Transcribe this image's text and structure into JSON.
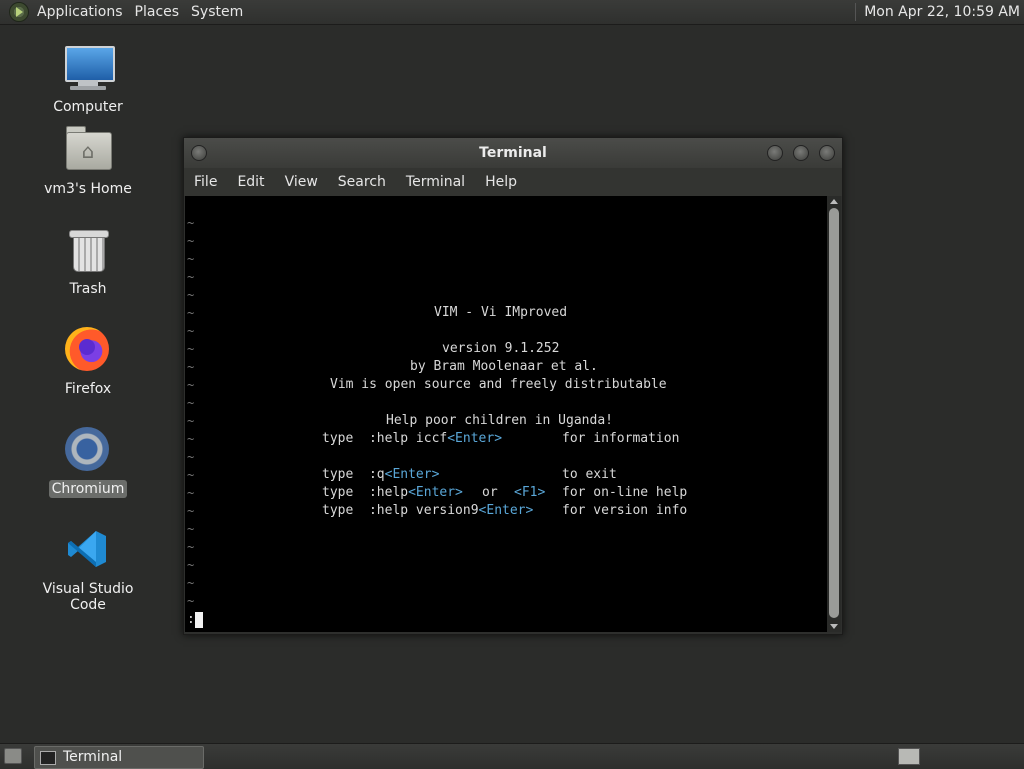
{
  "top_panel": {
    "menus": [
      "Applications",
      "Places",
      "System"
    ],
    "clock": "Mon Apr 22, 10:59 AM"
  },
  "desktop": {
    "icons": [
      {
        "label": "Computer",
        "icon": "computer-icon"
      },
      {
        "label": "vm3's Home",
        "icon": "home-folder-icon"
      },
      {
        "label": "Trash",
        "icon": "trash-icon"
      },
      {
        "label": "Firefox",
        "icon": "firefox-icon"
      },
      {
        "label": "Chromium",
        "icon": "chromium-icon",
        "selected": true
      },
      {
        "label": "Visual Studio Code",
        "icon": "vscode-icon"
      }
    ]
  },
  "terminal": {
    "title": "Terminal",
    "menu": [
      "File",
      "Edit",
      "View",
      "Search",
      "Terminal",
      "Help"
    ],
    "tilde": "~",
    "vim": {
      "title": "VIM - Vi IMproved",
      "version": "version 9.1.252",
      "author": "by Bram Moolenaar et al.",
      "license": "Vim is open source and freely distributable",
      "charity": "Help poor children in Uganda!",
      "help_lines": [
        {
          "pre": "type  :help iccf",
          "key": "<Enter>",
          "mid": "",
          "key2": "",
          "post": "for information"
        },
        {
          "pre": "type  :q",
          "key": "<Enter>",
          "mid": "",
          "key2": "",
          "post": "to exit"
        },
        {
          "pre": "type  :help",
          "key": "<Enter>",
          "mid": "or",
          "key2": "<F1>",
          "post": "for on-line help"
        },
        {
          "pre": "type  :help version9",
          "key": "<Enter>",
          "mid": "",
          "key2": "",
          "post": "for version info"
        }
      ]
    },
    "command_prompt": ":"
  },
  "bottom_panel": {
    "task_label": "Terminal"
  }
}
